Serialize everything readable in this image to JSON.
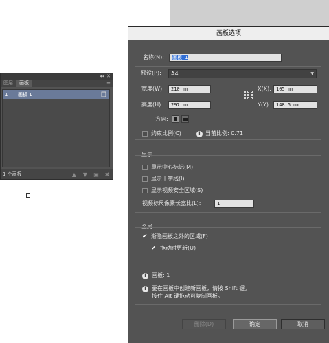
{
  "panel": {
    "tabs": [
      "图层",
      "画板"
    ],
    "top_controls": [
      "◂◂",
      "✕"
    ],
    "menu_icon": "≡",
    "rows": [
      {
        "num": "1",
        "name": "画板 1"
      }
    ],
    "row_icon": "artboard-options-icon",
    "footer_count": "1 个画板",
    "footer_icons": [
      "move-up-icon",
      "move-down-icon",
      "new-artboard-icon",
      "delete-icon"
    ]
  },
  "dialog": {
    "title": "画板选项",
    "name_label": "名称(N):",
    "name_value": "画板 1",
    "preset_label": "预设(P):",
    "preset_value": "A4",
    "width_label": "宽度(W):",
    "width_value": "210 mm",
    "height_label": "高度(H):",
    "height_value": "297 mm",
    "x_label": "X(X):",
    "x_value": "105 mm",
    "y_label": "Y(Y):",
    "y_value": "148.5 mm",
    "orientation_label": "方向:",
    "constrain_label": "约束比例(C)",
    "ratio_label": "当前比例: 0.71",
    "display": {
      "title": "显示",
      "center_mark": "显示中心标记(M)",
      "crosshairs": "显示十字线(I)",
      "video_safe": "显示视频安全区域(S)",
      "pixel_ratio_label": "视频标尺像素长宽比(L):",
      "pixel_ratio_value": "1"
    },
    "global": {
      "title": "全局",
      "fade_outside": "渐隐画板之外的区域(F)",
      "update_drag": "拖动时更新(U)"
    },
    "info_artboards": "画板: 1",
    "info_hint_1": "要在画板中创建新画板，请按 Shift 键。",
    "info_hint_2": "按住 Alt 键拖动可复制画板。",
    "buttons": {
      "delete": "删除(D)",
      "ok": "确定",
      "cancel": "取消"
    }
  },
  "colors": {
    "accent": "#2f6ed6",
    "panel_bg": "#535353",
    "row_highlight": "#6a7a99"
  }
}
